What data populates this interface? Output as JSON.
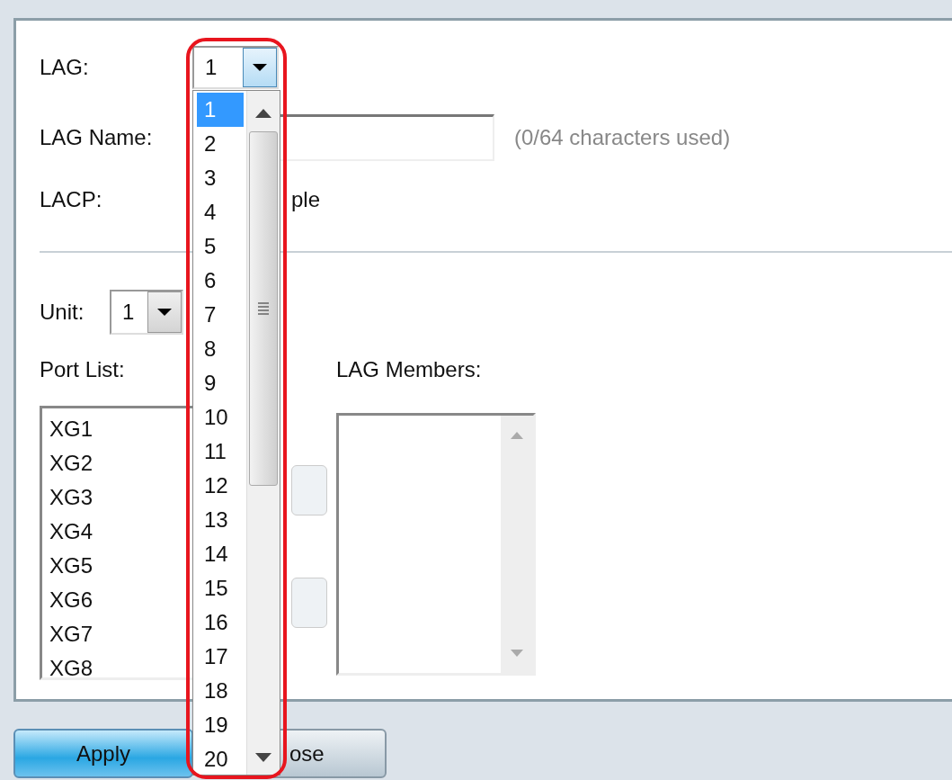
{
  "lag": {
    "label": "LAG:",
    "value": "1"
  },
  "lag_dropdown": {
    "options": [
      {
        "label": "1",
        "selected": true
      },
      {
        "label": "2",
        "selected": false
      },
      {
        "label": "3",
        "selected": false
      },
      {
        "label": "4",
        "selected": false
      },
      {
        "label": "5",
        "selected": false
      },
      {
        "label": "6",
        "selected": false
      },
      {
        "label": "7",
        "selected": false
      },
      {
        "label": "8",
        "selected": false
      },
      {
        "label": "9",
        "selected": false
      },
      {
        "label": "10",
        "selected": false
      },
      {
        "label": "11",
        "selected": false
      },
      {
        "label": "12",
        "selected": false
      },
      {
        "label": "13",
        "selected": false
      },
      {
        "label": "14",
        "selected": false
      },
      {
        "label": "15",
        "selected": false
      },
      {
        "label": "16",
        "selected": false
      },
      {
        "label": "17",
        "selected": false
      },
      {
        "label": "18",
        "selected": false
      },
      {
        "label": "19",
        "selected": false
      },
      {
        "label": "20",
        "selected": false
      }
    ]
  },
  "lag_name": {
    "label": "LAG Name:",
    "counter": "(0/64 characters used)"
  },
  "lacp": {
    "label": "LACP:",
    "text": "ple"
  },
  "unit": {
    "label": "Unit:",
    "value": "1"
  },
  "port_list": {
    "label": "Port List:",
    "ports": [
      "XG1",
      "XG2",
      "XG3",
      "XG4",
      "XG5",
      "XG6",
      "XG7",
      "XG8"
    ]
  },
  "lag_members": {
    "label": "LAG Members:"
  },
  "buttons": [
    {
      "label": "Apply",
      "kind": "primary"
    },
    {
      "label": "ose",
      "kind": "secondary"
    }
  ]
}
